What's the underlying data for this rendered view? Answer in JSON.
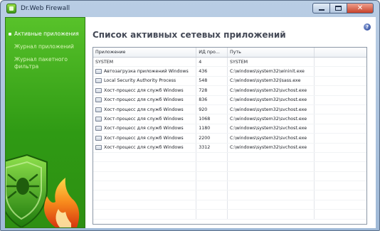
{
  "window": {
    "title": "Dr.Web Firewall",
    "controls": {
      "minimize": "",
      "maximize": "",
      "close": "✕"
    }
  },
  "sidebar": {
    "items": [
      {
        "label": "Активные приложения",
        "active": true
      },
      {
        "label": "Журнал приложений",
        "active": false
      },
      {
        "label": "Журнал пакетного фильтра",
        "active": false
      }
    ]
  },
  "main": {
    "title": "Список активных сетевых приложений",
    "help": "?",
    "table": {
      "headers": [
        "Приложение",
        "ИД про...",
        "Путь",
        ""
      ],
      "rows": [
        {
          "app": "SYSTEM",
          "pid": "4",
          "path": "SYSTEM",
          "icon": false
        },
        {
          "app": "Автозагрузка приложений Windows",
          "pid": "436",
          "path": "C:\\windows\\system32\\wininit.exe",
          "icon": true
        },
        {
          "app": "Local Security Authority Process",
          "pid": "548",
          "path": "C:\\windows\\system32\\lsass.exe",
          "icon": true
        },
        {
          "app": "Хост-процесс для служб Windows",
          "pid": "728",
          "path": "C:\\windows\\system32\\svchost.exe",
          "icon": true
        },
        {
          "app": "Хост-процесс для служб Windows",
          "pid": "836",
          "path": "C:\\windows\\system32\\svchost.exe",
          "icon": true
        },
        {
          "app": "Хост-процесс для служб Windows",
          "pid": "920",
          "path": "C:\\windows\\system32\\svchost.exe",
          "icon": true
        },
        {
          "app": "Хост-процесс для служб Windows",
          "pid": "1068",
          "path": "C:\\windows\\system32\\svchost.exe",
          "icon": true
        },
        {
          "app": "Хост-процесс для служб Windows",
          "pid": "1180",
          "path": "C:\\windows\\system32\\svchost.exe",
          "icon": true
        },
        {
          "app": "Хост-процесс для служб Windows",
          "pid": "2200",
          "path": "C:\\windows\\system32\\svchost.exe",
          "icon": true
        },
        {
          "app": "Хост-процесс для служб Windows",
          "pid": "3312",
          "path": "C:\\windows\\system32\\svchost.exe",
          "icon": true
        }
      ]
    }
  },
  "colors": {
    "sidebar_green": "#3aa31a",
    "title_gray": "#454a57",
    "flame_orange": "#f38a1c"
  }
}
